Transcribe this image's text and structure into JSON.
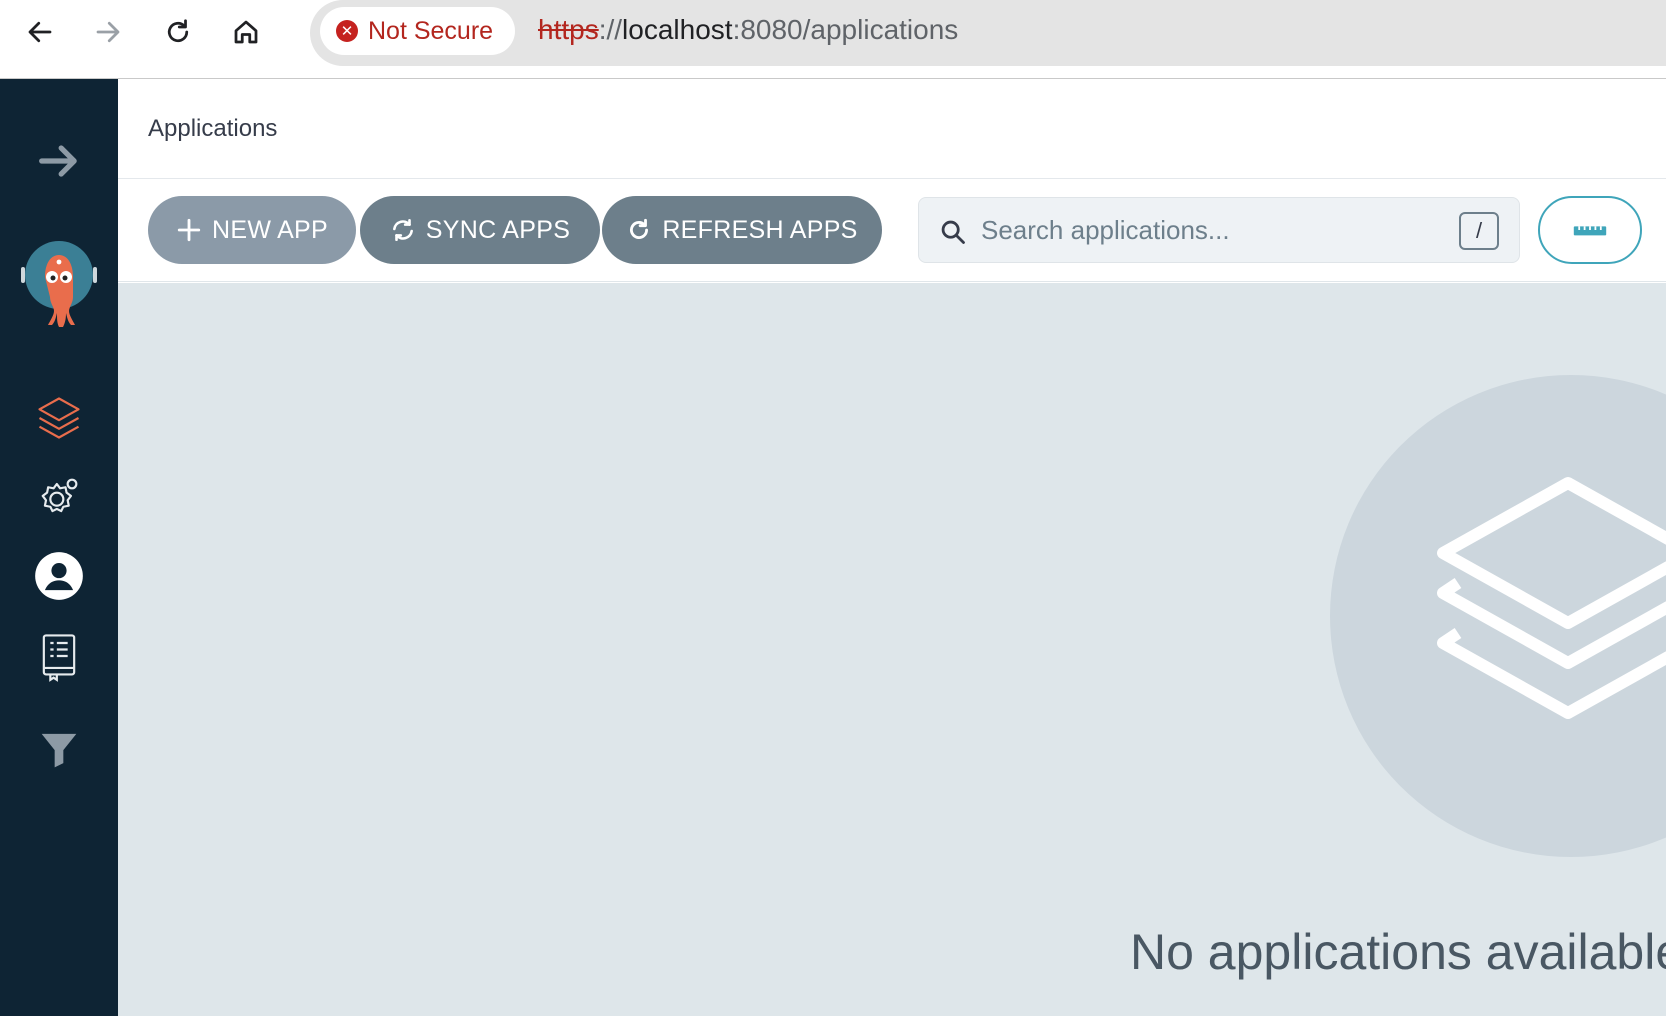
{
  "browser": {
    "security_label": "Not Secure",
    "url_scheme": "https",
    "url_separator": "://",
    "url_host": "localhost",
    "url_path": ":8080/applications",
    "icons": [
      "back-icon",
      "forward-icon",
      "reload-icon",
      "home-icon",
      "not-secure-icon"
    ]
  },
  "sidebar": {
    "items": [
      {
        "name": "expand-sidebar",
        "icon": "arrow-right-icon"
      },
      {
        "name": "logo",
        "icon": "argo-octopus-logo"
      },
      {
        "name": "applications",
        "icon": "layers-icon",
        "active": true
      },
      {
        "name": "settings",
        "icon": "gear-icon"
      },
      {
        "name": "user-info",
        "icon": "user-circle-icon"
      },
      {
        "name": "documentation",
        "icon": "book-icon"
      },
      {
        "name": "filters",
        "icon": "filter-icon"
      }
    ],
    "active_color": "#e96d4c"
  },
  "header": {
    "title": "Applications"
  },
  "toolbar": {
    "new_app_label": "NEW APP",
    "sync_apps_label": "SYNC APPS",
    "refresh_apps_label": "REFRESH APPS",
    "search_placeholder": "Search applications...",
    "search_value": "",
    "shortcut_hint": "/",
    "view_toggle_icon": "ruler-icon"
  },
  "main": {
    "empty_icon": "layers-icon",
    "empty_message": "No applications available"
  },
  "colors": {
    "sidebar_bg": "#0e2434",
    "main_bg": "#dee6ea",
    "button_gray": "#6d7f8b",
    "accent_teal": "#3fa5ba",
    "not_secure_red": "#b3261e"
  }
}
